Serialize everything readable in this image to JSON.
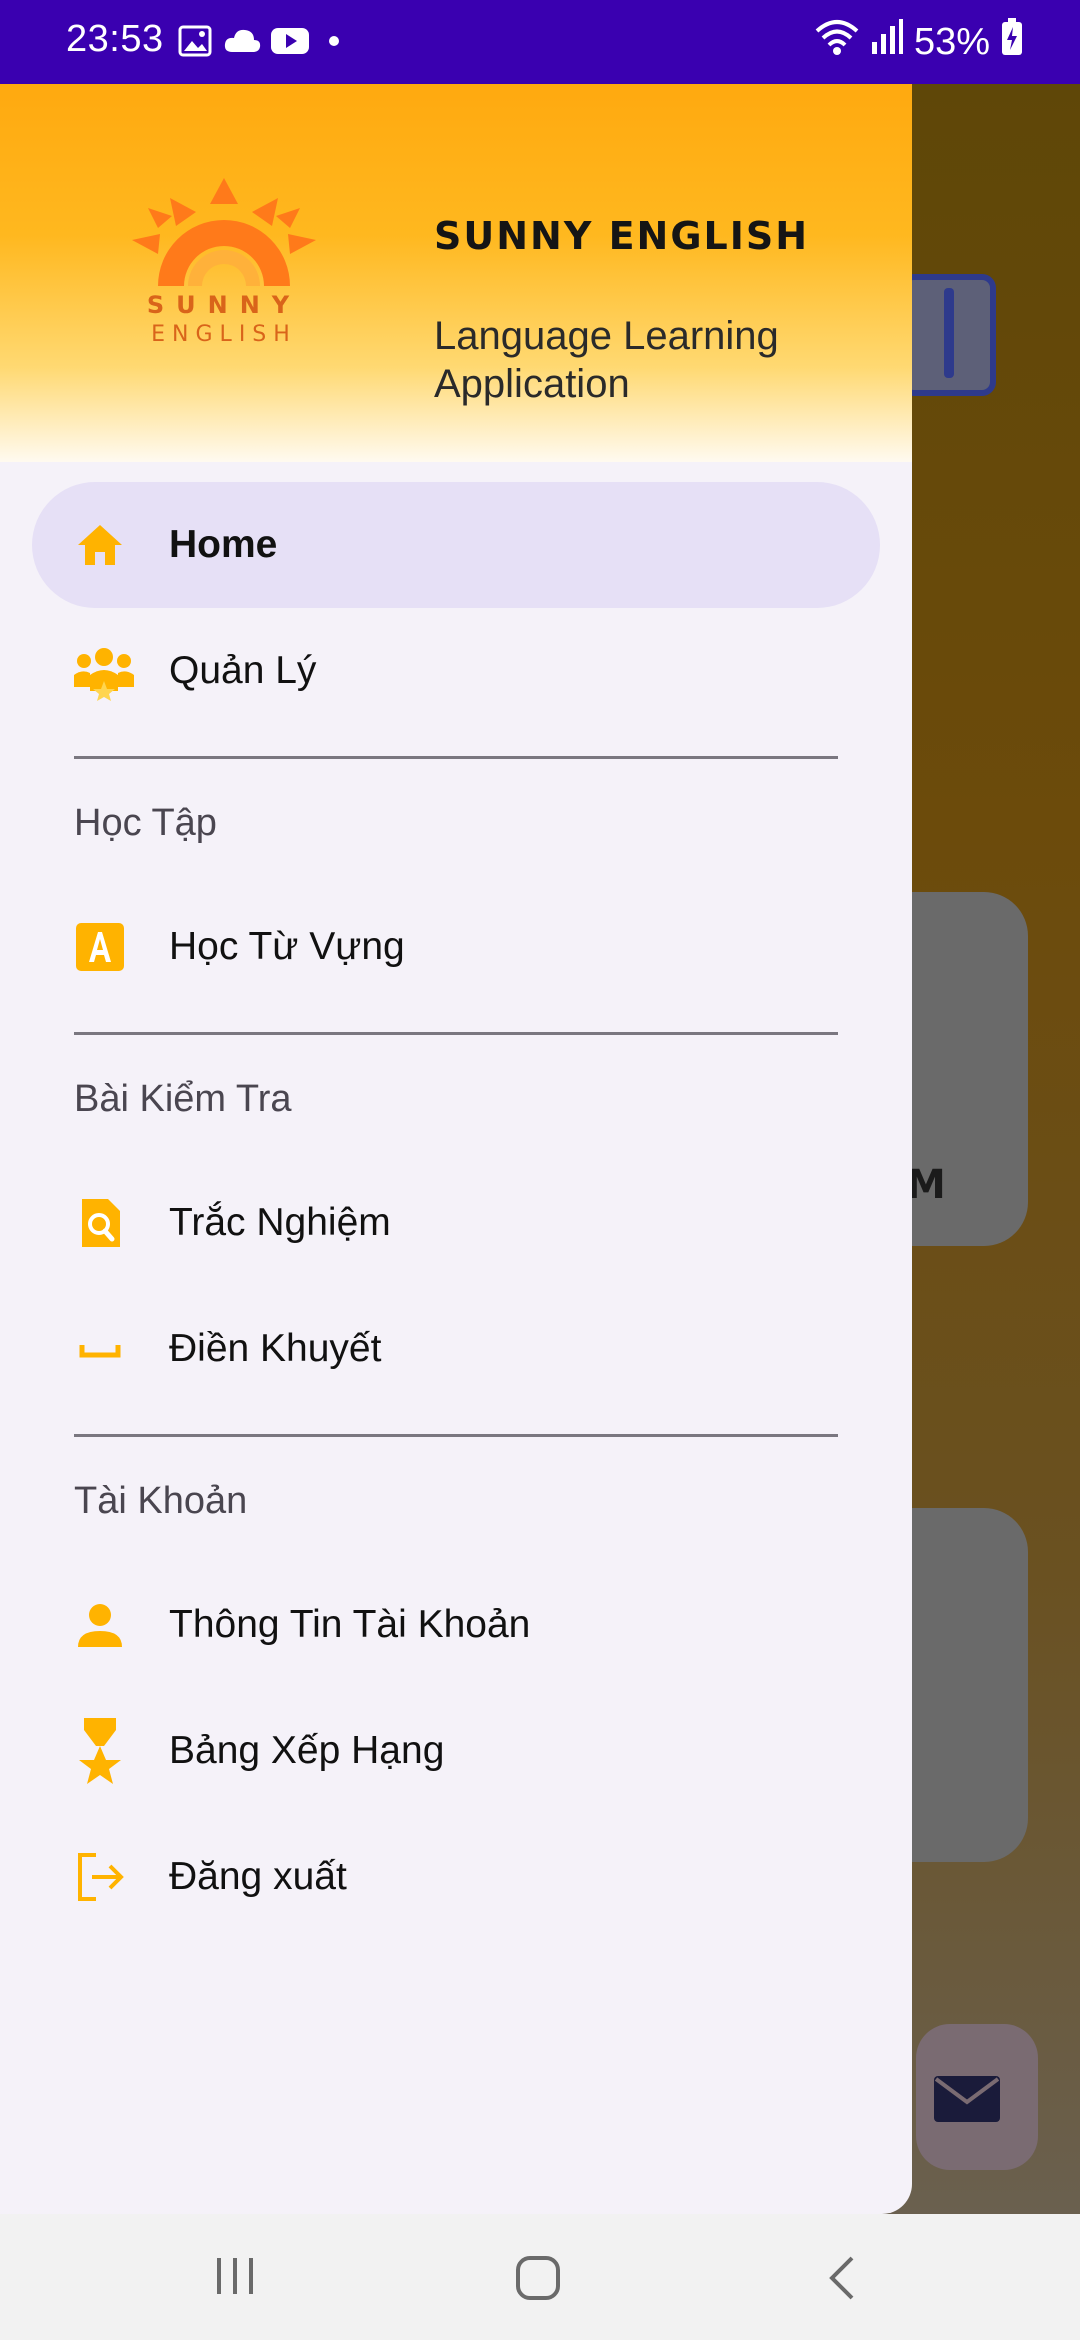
{
  "status_bar": {
    "time": "23:53",
    "battery": "53%",
    "left_icons": [
      "image-icon",
      "cloud-icon",
      "youtube-icon",
      "dot-icon"
    ],
    "right_icons": [
      "wifi-icon",
      "signal-icon",
      "battery-charging-icon"
    ]
  },
  "header": {
    "logo_line1": "SUNNY",
    "logo_line2": "ENGLISH",
    "title": "SUNNY ENGLISH",
    "subtitle": "Language Learning Application"
  },
  "menu": {
    "home": "Home",
    "manage": "Quản Lý",
    "section_learning": "Học Tập",
    "vocab": "Học Từ Vựng",
    "section_tests": "Bài Kiểm Tra",
    "quiz": "Trắc Nghiệm",
    "fill_blank": "Điền Khuyết",
    "section_account": "Tài Khoản",
    "account_info": "Thông Tin Tài Khoản",
    "leaderboard": "Bảng Xếp Hạng",
    "logout": "Đăng xuất"
  },
  "background": {
    "card_text": "M"
  },
  "colors": {
    "accent": "#FFB300",
    "status_bar": "#3A00B0",
    "selected_item": "#E6E0F6"
  }
}
